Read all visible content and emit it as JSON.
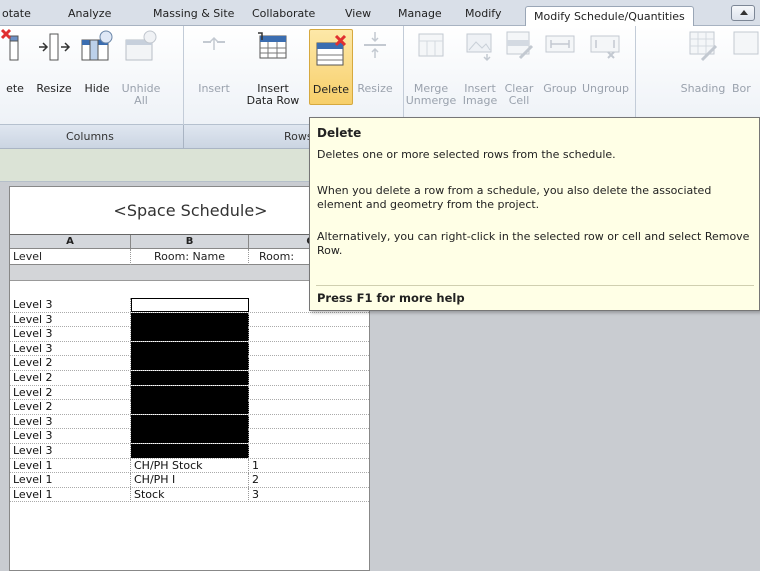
{
  "ribbon_tabs": [
    {
      "label": "otate",
      "active": false
    },
    {
      "label": "Analyze",
      "active": false
    },
    {
      "label": "Massing & Site",
      "active": false
    },
    {
      "label": "Collaborate",
      "active": false
    },
    {
      "label": "View",
      "active": false
    },
    {
      "label": "Manage",
      "active": false
    },
    {
      "label": "Modify",
      "active": false
    },
    {
      "label": "Modify Schedule/Quantities",
      "active": true
    }
  ],
  "ribbon_buttons": [
    {
      "label": "ete",
      "icon": "delete-column-icon",
      "enabled": true
    },
    {
      "label": "Resize",
      "icon": "resize-icon",
      "enabled": true
    },
    {
      "label": "Hide",
      "icon": "hide-column-icon",
      "enabled": true
    },
    {
      "label": "Unhide\nAll",
      "icon": "unhide-all-icon",
      "enabled": false
    },
    {
      "label": "Insert",
      "icon": "insert-row-icon",
      "enabled": false,
      "dropdown": true
    },
    {
      "label": "Insert\nData Row",
      "icon": "insert-data-row-icon",
      "enabled": true
    },
    {
      "label": "Delete",
      "icon": "delete-row-icon",
      "enabled": true,
      "selected": true
    },
    {
      "label": "Resize",
      "icon": "resize-row-icon",
      "enabled": false
    },
    {
      "label": "Merge\nUnmerge",
      "icon": "merge-icon",
      "enabled": false
    },
    {
      "label": "Insert\nImage",
      "icon": "insert-image-icon",
      "enabled": false
    },
    {
      "label": "Clear\nCell",
      "icon": "clear-cell-icon",
      "enabled": false
    },
    {
      "label": "Group",
      "icon": "group-icon",
      "enabled": false
    },
    {
      "label": "Ungroup",
      "icon": "ungroup-icon",
      "enabled": false
    },
    {
      "label": "Shading",
      "icon": "shading-icon",
      "enabled": false
    },
    {
      "label": "Bor",
      "icon": "borders-icon",
      "enabled": false
    }
  ],
  "panels": {
    "columns": "Columns",
    "rows": "Rows"
  },
  "tooltip": {
    "title": "Delete",
    "line1": "Deletes one or more selected rows from the schedule.",
    "para2": "When you delete a row from a schedule, you also delete the associated element and geometry from the project.",
    "para3": "Alternatively, you can right-click in the selected row or cell and select Remove Row.",
    "help": "Press F1 for more help"
  },
  "schedule": {
    "title": "<Space Schedule>",
    "column_letters": [
      "A",
      "B",
      "C"
    ],
    "field_headers": [
      "Level",
      "Room: Name",
      "Room:"
    ],
    "rows": [
      {
        "level": "Level 3",
        "name": "",
        "c": "",
        "state": "outlined"
      },
      {
        "level": "Level 3",
        "name": "",
        "c": "",
        "state": "selected"
      },
      {
        "level": "Level 3",
        "name": "",
        "c": "",
        "state": "selected"
      },
      {
        "level": "Level 3",
        "name": "",
        "c": "",
        "state": "selected"
      },
      {
        "level": "Level 2",
        "name": "",
        "c": "",
        "state": "selected"
      },
      {
        "level": "Level 2",
        "name": "",
        "c": "",
        "state": "selected"
      },
      {
        "level": "Level 2",
        "name": "",
        "c": "",
        "state": "selected"
      },
      {
        "level": "Level 2",
        "name": "",
        "c": "",
        "state": "selected"
      },
      {
        "level": "Level 3",
        "name": "",
        "c": "",
        "state": "selected"
      },
      {
        "level": "Level 3",
        "name": "",
        "c": "",
        "state": "selected"
      },
      {
        "level": "Level 3",
        "name": "",
        "c": "",
        "state": "selected"
      },
      {
        "level": "Level 1",
        "name": "CH/PH Stock",
        "c": "1",
        "state": "normal"
      },
      {
        "level": "Level 1",
        "name": "CH/PH I",
        "c": "2",
        "state": "normal"
      },
      {
        "level": "Level 1",
        "name": "Stock",
        "c": "3",
        "state": "normal"
      }
    ]
  },
  "colors": {
    "active_tab": "#ffffff",
    "selected_button": "#f7cf6a",
    "tooltip_bg": "#ffffe6",
    "selected_cell": "#000000"
  }
}
